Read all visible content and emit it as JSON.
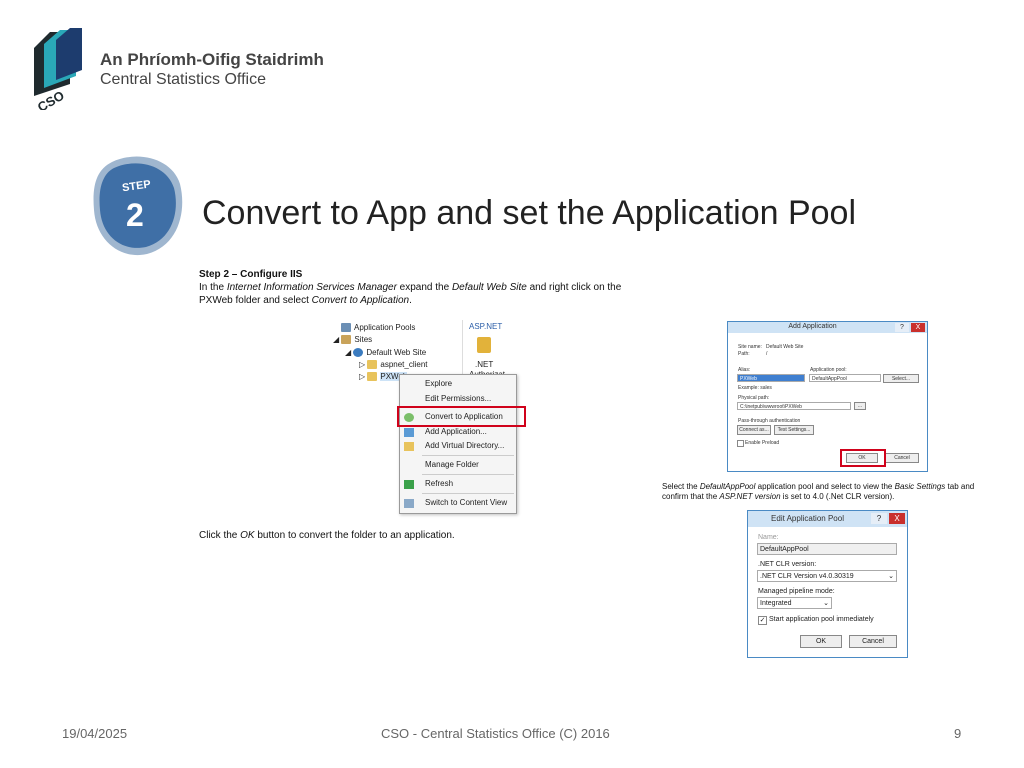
{
  "logo": {
    "irish_name": "An Phríomh-Oifig Staidrimh",
    "english_name": "Central Statistics Office",
    "mark_text": "CSO",
    "colors": {
      "teal": "#2aa8b8",
      "navy": "#1d3c6e",
      "dark": "#1f2a2e"
    }
  },
  "badge": {
    "step_word": "STEP",
    "step_number": "2",
    "color": "#3f6fa6"
  },
  "title": "Convert to App and set the Application Pool",
  "instructions": {
    "heading": "Step 2 – Configure IIS",
    "text_1": "In the ",
    "em_1": "Internet Information Services Manager",
    "text_2": " expand the ",
    "em_2": "Default Web Site",
    "text_3": " and right click on the PXWeb folder and select ",
    "em_3": "Convert to Application",
    "text_4": "."
  },
  "tree": {
    "items": [
      "Application Pools",
      "Sites",
      "Default Web Site",
      "aspnet_client",
      "PXWeb"
    ],
    "panel_title": "ASP.NET",
    "panel_item": ".NET",
    "panel_item_sub": "Authorizat..."
  },
  "context_menu": {
    "items": [
      "Explore",
      "Edit Permissions...",
      "Convert to Application",
      "Add Application...",
      "Add Virtual Directory...",
      "Manage Folder",
      "Refresh",
      "Switch to Content View"
    ],
    "highlight_color": "#d0021b"
  },
  "add_app_dialog": {
    "title": "Add Application",
    "help": "?",
    "close": "X",
    "site_name_label": "Site name:",
    "site_name_value": "Default Web Site",
    "path_label": "Path:",
    "path_value": "/",
    "alias_label": "Alias:",
    "alias_value": "PXWeb",
    "app_pool_label": "Application pool:",
    "app_pool_value": "DefaultAppPool",
    "select_button": "Select...",
    "example_label": "Example: sales",
    "physical_path_label": "Physical path:",
    "physical_path_value": "C:\\inetpub\\wwwroot\\PXWeb",
    "browse_button": "...",
    "passthrough_label": "Pass-through authentication",
    "connect_button": "Connect as...",
    "test_button": "Test Settings...",
    "preload_label": "Enable Preload",
    "ok_button": "OK",
    "cancel_button": "Cancel"
  },
  "caption": {
    "text_1": "Select the ",
    "em_1": "DefaultAppPool",
    "text_2": " application pool and select to view the ",
    "em_2": "Basic Settings",
    "text_3": " tab and confirm that the ",
    "em_3": "ASP.NET version",
    "text_4": " is set to 4.0 (.Net CLR version)."
  },
  "edit_pool_dialog": {
    "title": "Edit Application Pool",
    "help": "?",
    "close": "X",
    "name_label": "Name:",
    "name_value": "DefaultAppPool",
    "clr_label": ".NET CLR version:",
    "clr_value": ".NET CLR Version v4.0.30319",
    "pipeline_label": "Managed pipeline mode:",
    "pipeline_value": "Integrated",
    "start_label": "Start application pool immediately",
    "ok_button": "OK",
    "cancel_button": "Cancel"
  },
  "bottom_instruction": {
    "text_1": "Click the ",
    "em_1": "OK",
    "text_2": " button to convert the folder to an application."
  },
  "footer": {
    "date": "19/04/2025",
    "center": "CSO - Central Statistics Office (C) 2016",
    "page": "9"
  }
}
